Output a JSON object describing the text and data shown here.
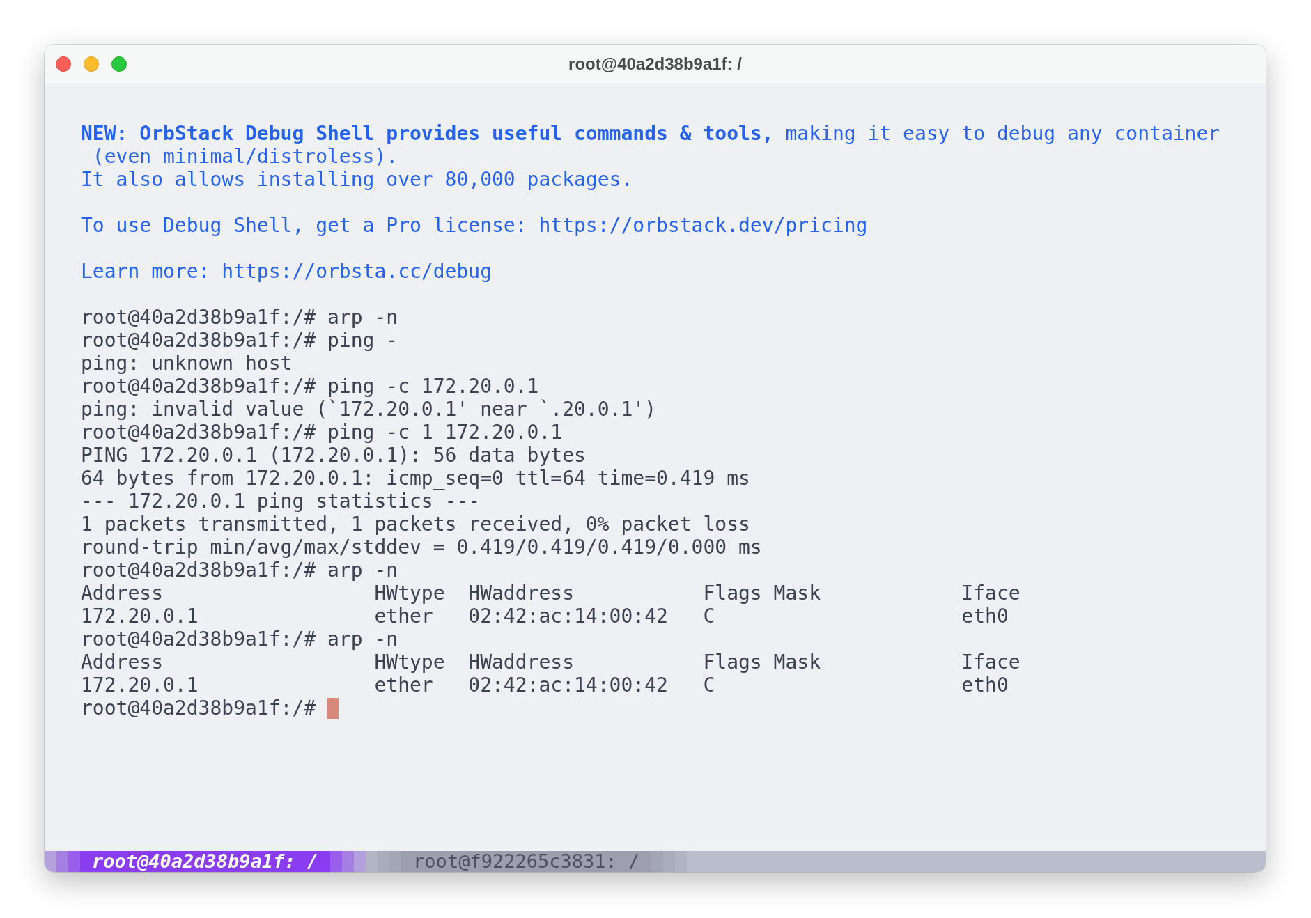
{
  "window": {
    "title": "root@40a2d38b9a1f: /"
  },
  "terminal": {
    "cursor_visible": true,
    "lines": [
      {
        "kind": "notice",
        "text": "**NEW: OrbStack Debug Shell provides useful commands & tools,** making it easy to debug any container"
      },
      {
        "kind": "notice",
        "text": " (even minimal/distroless)."
      },
      {
        "kind": "notice",
        "text": "It also allows installing over 80,000 packages."
      },
      {
        "kind": "spacer"
      },
      {
        "kind": "notice",
        "text": "To use Debug Shell, get a Pro license: https://orbstack.dev/pricing"
      },
      {
        "kind": "spacer"
      },
      {
        "kind": "notice",
        "text": "Learn more: https://orbsta.cc/debug"
      },
      {
        "kind": "spacer"
      },
      {
        "kind": "output",
        "text": "root@40a2d38b9a1f:/# arp -n"
      },
      {
        "kind": "output",
        "text": "root@40a2d38b9a1f:/# ping -"
      },
      {
        "kind": "output",
        "text": "ping: unknown host"
      },
      {
        "kind": "output",
        "text": "root@40a2d38b9a1f:/# ping -c 172.20.0.1"
      },
      {
        "kind": "output",
        "text": "ping: invalid value (`172.20.0.1' near `.20.0.1')"
      },
      {
        "kind": "output",
        "text": "root@40a2d38b9a1f:/# ping -c 1 172.20.0.1"
      },
      {
        "kind": "output",
        "text": "PING 172.20.0.1 (172.20.0.1): 56 data bytes"
      },
      {
        "kind": "output",
        "text": "64 bytes from 172.20.0.1: icmp_seq=0 ttl=64 time=0.419 ms"
      },
      {
        "kind": "output",
        "text": "--- 172.20.0.1 ping statistics ---"
      },
      {
        "kind": "output",
        "text": "1 packets transmitted, 1 packets received, 0% packet loss"
      },
      {
        "kind": "output",
        "text": "round-trip min/avg/max/stddev = 0.419/0.419/0.419/0.000 ms"
      },
      {
        "kind": "output",
        "text": "root@40a2d38b9a1f:/# arp -n"
      },
      {
        "kind": "output",
        "text": "Address                  HWtype  HWaddress           Flags Mask            Iface"
      },
      {
        "kind": "output",
        "text": "172.20.0.1               ether   02:42:ac:14:00:42   C                     eth0"
      },
      {
        "kind": "output",
        "text": "root@40a2d38b9a1f:/# arp -n"
      },
      {
        "kind": "output",
        "text": "Address                  HWtype  HWaddress           Flags Mask            Iface"
      },
      {
        "kind": "output",
        "text": "172.20.0.1               ether   02:42:ac:14:00:42   C                     eth0"
      },
      {
        "kind": "output",
        "text": "root@40a2d38b9a1f:/# "
      }
    ]
  },
  "tabs": [
    {
      "label": "root@40a2d38b9a1f: /",
      "selected": true
    },
    {
      "label": "root@f922265c3831: /",
      "selected": false
    }
  ]
}
